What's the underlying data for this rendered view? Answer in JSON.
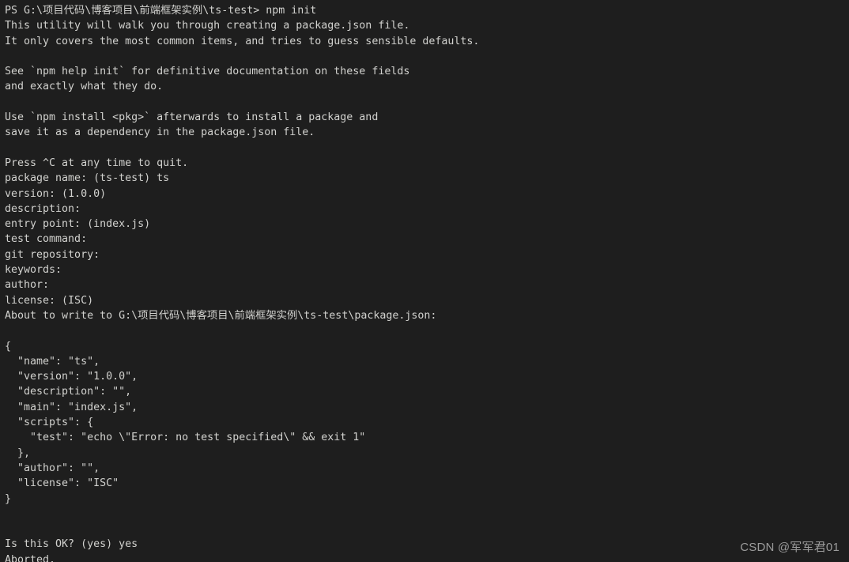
{
  "terminal": {
    "shell": "PowerShell",
    "background_color": "#1e1e1e",
    "text_color": "#d2d2cf",
    "prompt_prefix": "PS",
    "working_directory": "G:\\项目代码\\博客项目\\前端框架实例\\ts-test",
    "command": "npm init",
    "lines": [
      "PS G:\\项目代码\\博客项目\\前端框架实例\\ts-test> npm init",
      "This utility will walk you through creating a package.json file.",
      "It only covers the most common items, and tries to guess sensible defaults.",
      "",
      "See `npm help init` for definitive documentation on these fields",
      "and exactly what they do.",
      "",
      "Use `npm install <pkg>` afterwards to install a package and",
      "save it as a dependency in the package.json file.",
      "",
      "Press ^C at any time to quit.",
      "package name: (ts-test) ts",
      "version: (1.0.0)",
      "description:",
      "entry point: (index.js)",
      "test command:",
      "git repository:",
      "keywords:",
      "author:",
      "license: (ISC)",
      "About to write to G:\\项目代码\\博客项目\\前端框架实例\\ts-test\\package.json:",
      "",
      "{",
      "  \"name\": \"ts\",",
      "  \"version\": \"1.0.0\",",
      "  \"description\": \"\",",
      "  \"main\": \"index.js\",",
      "  \"scripts\": {",
      "    \"test\": \"echo \\\"Error: no test specified\\\" && exit 1\"",
      "  },",
      "  \"author\": \"\",",
      "  \"license\": \"ISC\"",
      "}",
      "",
      "",
      "Is this OK? (yes) yes",
      "Aborted."
    ],
    "prompts": {
      "package_name": {
        "label": "package name:",
        "default": "(ts-test)",
        "entered": "ts"
      },
      "version": {
        "label": "version:",
        "default": "(1.0.0)",
        "entered": ""
      },
      "description": {
        "label": "description:",
        "default": "",
        "entered": ""
      },
      "entry_point": {
        "label": "entry point:",
        "default": "(index.js)",
        "entered": ""
      },
      "test_command": {
        "label": "test command:",
        "default": "",
        "entered": ""
      },
      "git_repository": {
        "label": "git repository:",
        "default": "",
        "entered": ""
      },
      "keywords": {
        "label": "keywords:",
        "default": "",
        "entered": ""
      },
      "author": {
        "label": "author:",
        "default": "",
        "entered": ""
      },
      "license": {
        "label": "license:",
        "default": "(ISC)",
        "entered": ""
      },
      "confirm": {
        "label": "Is this OK?",
        "default": "(yes)",
        "entered": "yes"
      }
    },
    "package_json": {
      "name": "ts",
      "version": "1.0.0",
      "description": "",
      "main": "index.js",
      "scripts": {
        "test": "echo \"Error: no test specified\" && exit 1"
      },
      "author": "",
      "license": "ISC"
    },
    "final_status": "Aborted."
  },
  "watermark": {
    "text": "CSDN @军军君01",
    "color": "#9b9b9b"
  }
}
